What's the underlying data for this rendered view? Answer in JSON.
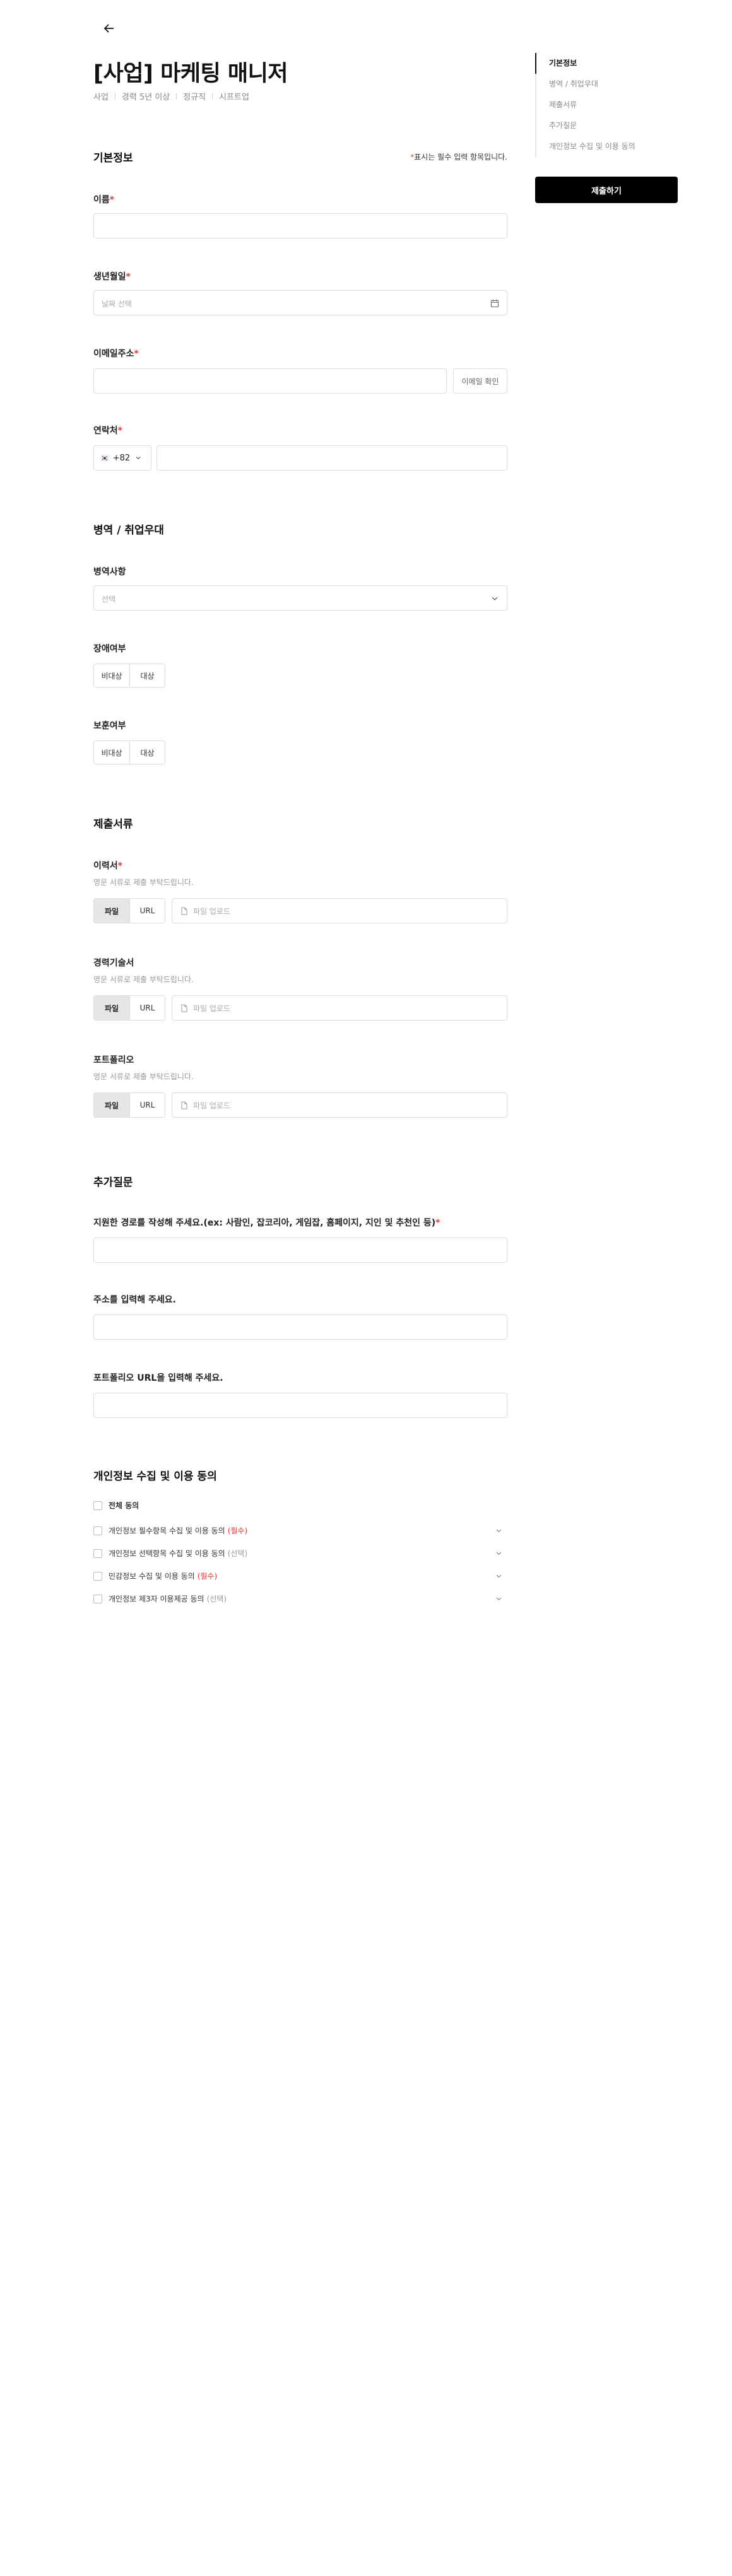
{
  "header": {
    "title": "[사업] 마케팅 매니저",
    "meta": [
      "사업",
      "경력 5년 이상",
      "정규직",
      "시프트업"
    ]
  },
  "basic": {
    "title": "기본정보",
    "required_note_star": "*",
    "required_note": "표시는 필수 입력 항목입니다.",
    "name_label": "이름",
    "birth_label": "생년월일",
    "birth_placeholder": "날짜 선택",
    "email_label": "이메일주소",
    "email_check": "이메일 확인",
    "phone_label": "연락처",
    "phone_code": "+82",
    "phone_flag": "🇰🇷"
  },
  "military": {
    "title": "병역 / 취업우대",
    "military_label": "병역사항",
    "military_placeholder": "선택",
    "disability_label": "장애여부",
    "veteran_label": "보훈여부",
    "options": [
      "비대상",
      "대상"
    ]
  },
  "docs": {
    "title": "제출서류",
    "resume_label": "이력서",
    "career_label": "경력기술서",
    "portfolio_label": "포트폴리오",
    "hint": "영문 서류로 제출 부탁드립니다.",
    "tab_file": "파일",
    "tab_url": "URL",
    "upload_placeholder": "파일 업로드"
  },
  "extra": {
    "title": "추가질문",
    "q1": "지원한 경로를 작성해 주세요.(ex: 사람인, 잡코리아, 게임잡, 홈페이지, 지인 및 추천인 등)",
    "q2": "주소를 입력해 주세요.",
    "q3": "포트폴리오 URL을 입력해 주세요."
  },
  "privacy": {
    "title": "개인정보 수집 및 이용 동의",
    "all": "전체 동의",
    "items": [
      {
        "text": "개인정보 필수항목 수집 및 이용 동의",
        "tag": "(필수)",
        "required": true
      },
      {
        "text": "개인정보 선택항목 수집 및 이용 동의",
        "tag": "(선택)",
        "required": false
      },
      {
        "text": "민감정보 수집 및 이용 동의",
        "tag": "(필수)",
        "required": true
      },
      {
        "text": "개인정보 제3자 이용제공 동의",
        "tag": "(선택)",
        "required": false
      }
    ]
  },
  "sidebar": {
    "nav": [
      "기본정보",
      "병역 / 취업우대",
      "제출서류",
      "추가질문",
      "개인정보 수집 및 이용 동의"
    ],
    "submit": "제출하기"
  },
  "colors": {
    "required": "#e53935",
    "submit_bg": "#000000"
  },
  "icons": [
    "back-arrow-icon",
    "calendar-icon",
    "chevron-down-icon",
    "file-icon"
  ]
}
